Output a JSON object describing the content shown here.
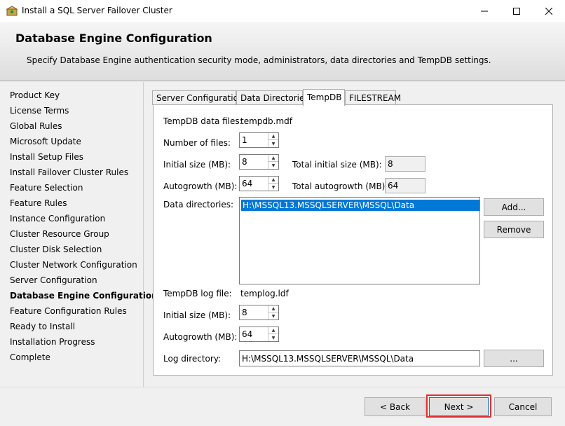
{
  "window": {
    "title": "Install a SQL Server Failover Cluster"
  },
  "header": {
    "title": "Database Engine Configuration",
    "subtitle": "Specify Database Engine authentication security mode, administrators, data directories and TempDB settings."
  },
  "nav": {
    "items": [
      "Product Key",
      "License Terms",
      "Global Rules",
      "Microsoft Update",
      "Install Setup Files",
      "Install Failover Cluster Rules",
      "Feature Selection",
      "Feature Rules",
      "Instance Configuration",
      "Cluster Resource Group",
      "Cluster Disk Selection",
      "Cluster Network Configuration",
      "Server Configuration",
      "Database Engine Configuration",
      "Feature Configuration Rules",
      "Ready to Install",
      "Installation Progress",
      "Complete"
    ],
    "active_index": 13
  },
  "tabs": [
    "Server Configuration",
    "Data Directories",
    "TempDB",
    "FILESTREAM"
  ],
  "tempdb": {
    "data_files_label": "TempDB data files:",
    "data_files_value": "tempdb.mdf",
    "num_files_label": "Number of files:",
    "num_files_value": "1",
    "initial_size_label": "Initial size (MB):",
    "initial_size_value": "8",
    "total_initial_label": "Total initial size (MB):",
    "total_initial_value": "8",
    "autogrowth_label": "Autogrowth (MB):",
    "autogrowth_value": "64",
    "total_autogrowth_label": "Total autogrowth (MB):",
    "total_autogrowth_value": "64",
    "data_dirs_label": "Data directories:",
    "data_dirs": [
      "H:\\MSSQL13.MSSQLSERVER\\MSSQL\\Data"
    ],
    "add_button": "Add...",
    "remove_button": "Remove",
    "log_file_label": "TempDB log file:",
    "log_file_value": "templog.ldf",
    "log_initial_label": "Initial size (MB):",
    "log_initial_value": "8",
    "log_autogrowth_label": "Autogrowth (MB):",
    "log_autogrowth_value": "64",
    "log_dir_label": "Log directory:",
    "log_dir_value": "H:\\MSSQL13.MSSQLSERVER\\MSSQL\\Data",
    "browse_button": "..."
  },
  "footer": {
    "back": "< Back",
    "next": "Next >",
    "cancel": "Cancel"
  },
  "colors": {
    "selection": "#0078d7",
    "highlight": "#e03030"
  }
}
